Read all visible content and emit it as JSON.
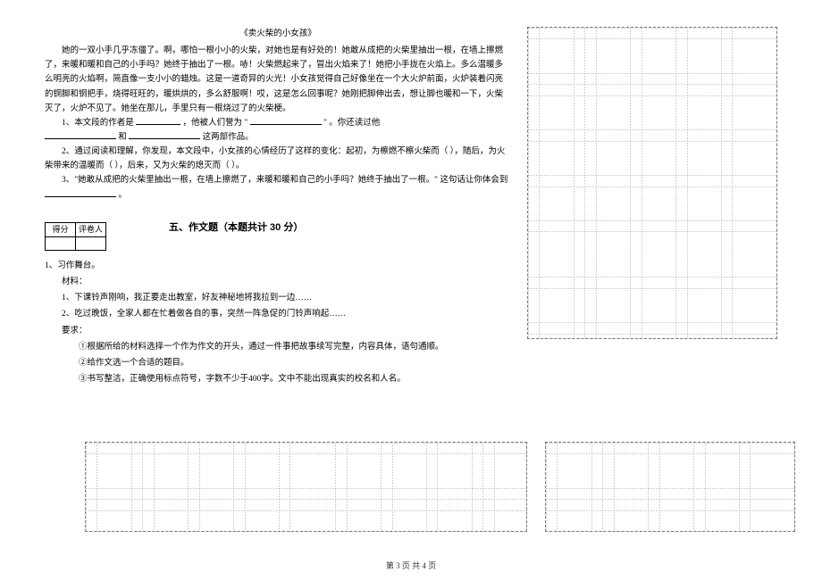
{
  "passage": {
    "title": "《卖火柴的小女孩》",
    "p1": "她的一双小手几乎冻僵了。啊，哪怕一根小小的火柴，对她也是有好处的！她敢从成把的火柴里抽出一根，在墙上擦燃了，来暖和暖和自己的小手吗？她终于抽出了一根。哧！火柴燃起来了，冒出火焰来了！她把小手拢在火焰上。多么温暖多么明亮的火焰啊，简直像一支小小的蜡烛。这是一道奇异的火光！小女孩觉得自己好像坐在一个大火炉前面，火炉装着闪亮的铜脚和铜把手，烧得旺旺的，暖烘烘的，多么舒服啊！哎，这是怎么回事呢？她刚把脚伸出去，想让脚也暖和一下，火柴灭了，火炉不见了。她坐在那儿，手里只有一根烧过了的火柴梗。",
    "q1a": "1、本文段的作者是",
    "q1b": "，他被人们誉为 \"",
    "q1c": "\" 。你还读过他",
    "q1pre": "和",
    "q1d": "这两部作品。",
    "q2a": "2、通过阅读和理解，你发现，本文段中，小女孩的心情经历了这样的变化：起初，为檫燃不檫火柴而（       ），随后，为火柴带来的温暖而（       ），后来，又为火柴的熄灭而（       ）。",
    "q3a": "3、\"她敢从成把的火柴里抽出一根，在墙上擦燃了，来暖和暖和自己的小手吗？她终于抽出了一根。\" 这句话让你体会到",
    "q3b": "。"
  },
  "scorebox": {
    "c1": "得分",
    "c2": "评卷人"
  },
  "section5": {
    "title": "五、作文题（本题共计 30 分）",
    "q1": "1、习作舞台。",
    "mat_label": "材料：",
    "mat1": "1、下课铃声刚响，我正要走出教室，好友神秘地将我拉到一边……",
    "mat2": "2、吃过晚饭，全家人都在忙着做各自的事，突然一阵急促的门铃声响起……",
    "req_label": "要求：",
    "req1": "①根据所给的材料选择一个作为作文的开头，通过一件事把故事续写完整，内容具体，语句通顺。",
    "req2": "②给作文选一个合适的题目。",
    "req3": "③书写整洁，正确使用标点符号，字数不少于400字。文中不能出现真实的校名和人名。"
  },
  "footer": "第 3 页 共 4 页"
}
